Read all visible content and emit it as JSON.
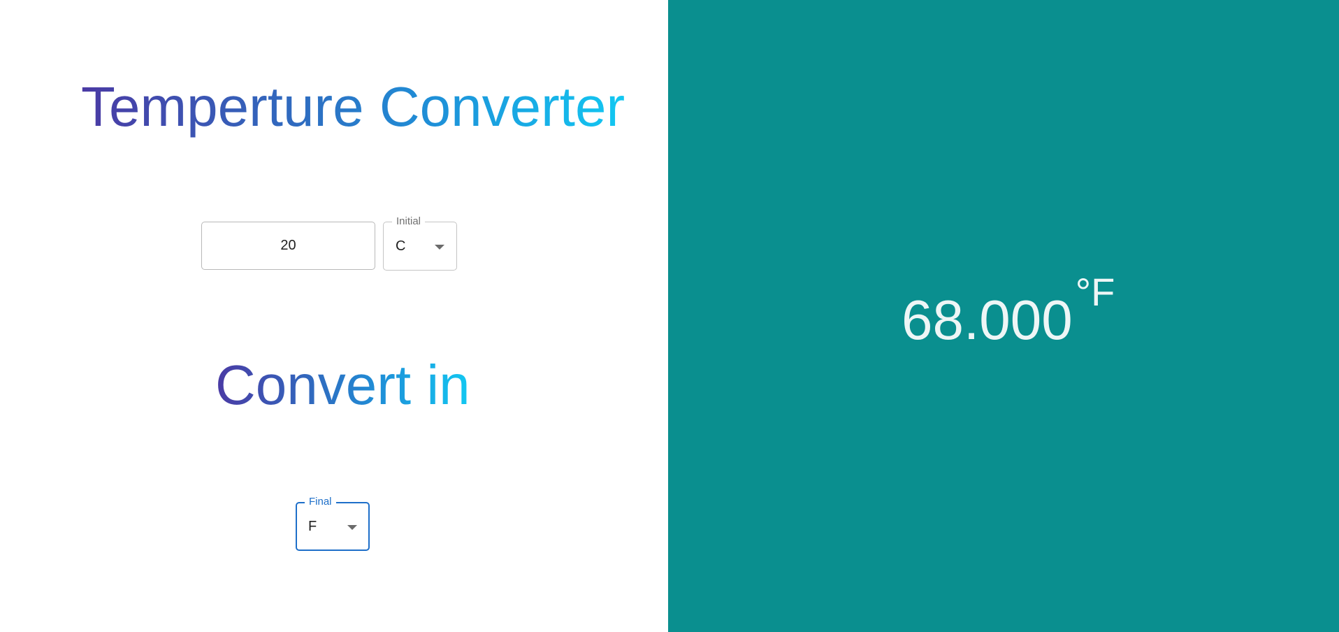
{
  "header": {
    "title": "Temperture Converter"
  },
  "input": {
    "value": "20"
  },
  "initial_select": {
    "label": "Initial",
    "selected": "C"
  },
  "section": {
    "title": "Convert in"
  },
  "final_select": {
    "label": "Final",
    "selected": "F"
  },
  "result": {
    "value": "68.000",
    "unit": "°F"
  },
  "colors": {
    "result_background": "#0a8f8f",
    "accent": "#1e6fc9",
    "gradient_start": "#4a3aa4",
    "gradient_end": "#12c8f2"
  },
  "icons": {
    "dropdown": "chevron-down-icon"
  }
}
